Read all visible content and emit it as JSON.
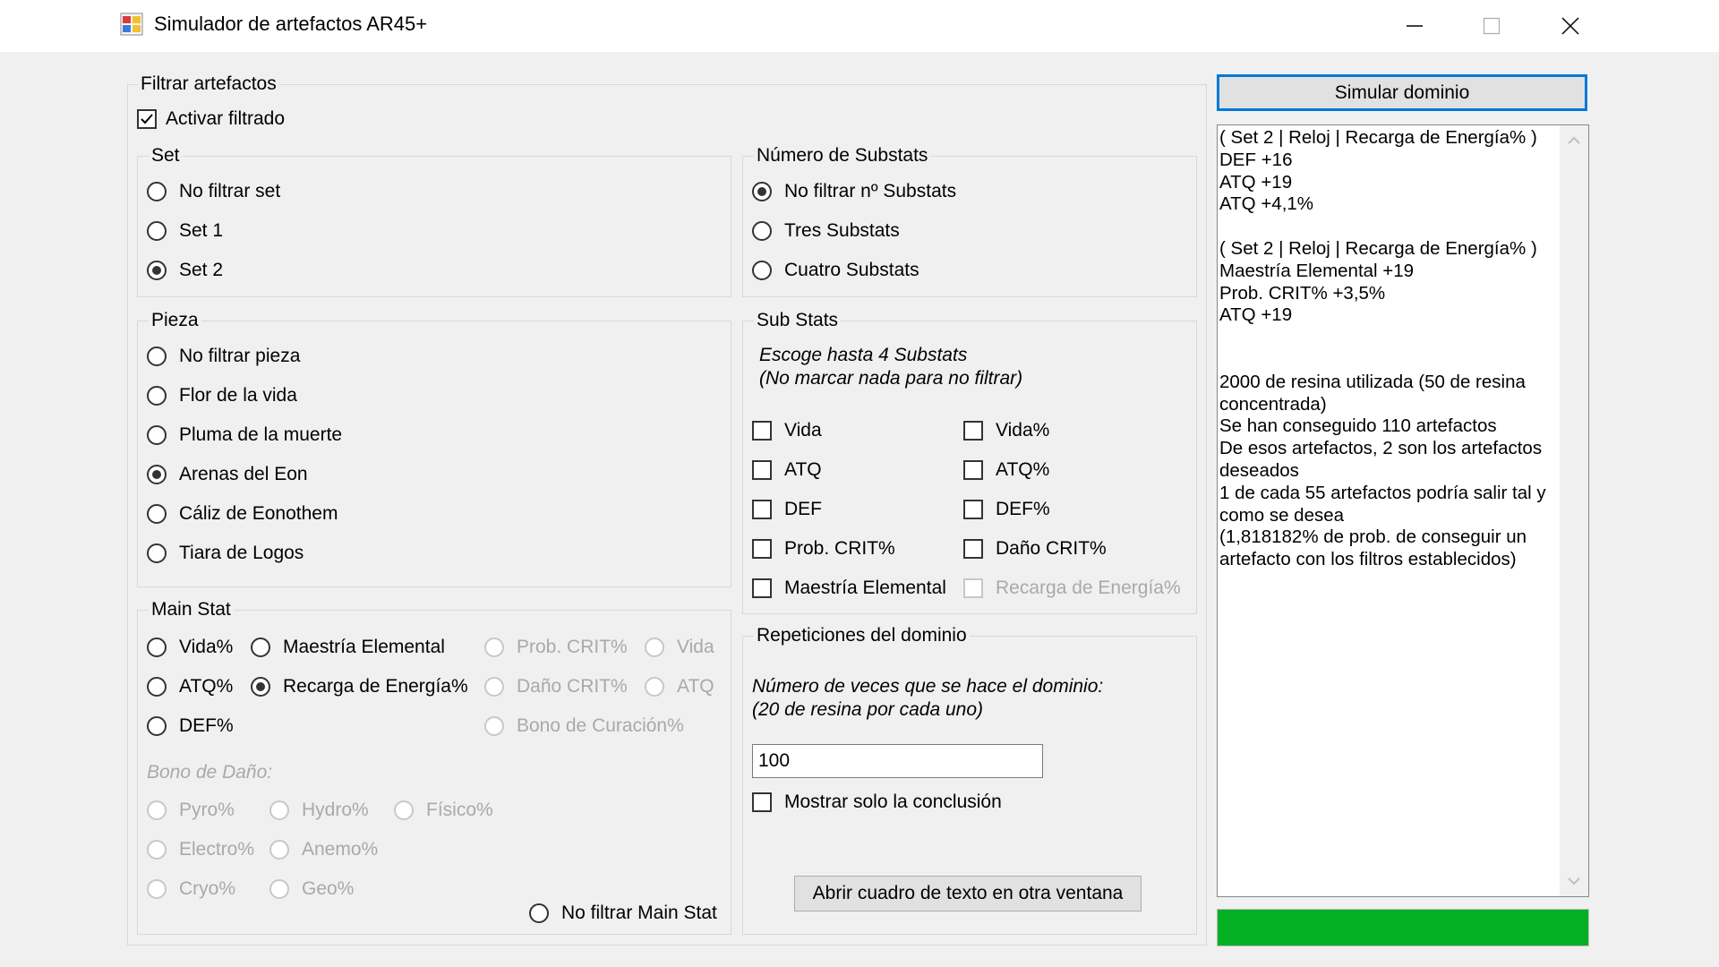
{
  "window": {
    "title": "Simulador de artefactos AR45+"
  },
  "filter": {
    "title": "Filtrar artefactos",
    "activate_label": "Activar filtrado",
    "activate_checked": true
  },
  "set": {
    "title": "Set",
    "options": [
      {
        "label": "No filtrar set",
        "checked": false
      },
      {
        "label": "Set 1",
        "checked": false
      },
      {
        "label": "Set 2",
        "checked": true
      }
    ]
  },
  "pieza": {
    "title": "Pieza",
    "options": [
      {
        "label": "No filtrar pieza",
        "checked": false
      },
      {
        "label": "Flor de la vida",
        "checked": false
      },
      {
        "label": "Pluma de la muerte",
        "checked": false
      },
      {
        "label": "Arenas del Eon",
        "checked": true
      },
      {
        "label": "Cáliz de Eonothem",
        "checked": false
      },
      {
        "label": "Tiara de Logos",
        "checked": false
      }
    ]
  },
  "main_stat": {
    "title": "Main Stat",
    "vida_pct": "Vida%",
    "maestria": "Maestría Elemental",
    "prob_crit": "Prob. CRIT%",
    "vida": "Vida",
    "atq_pct": "ATQ%",
    "recarga": "Recarga de Energía%",
    "danio_crit": "Daño CRIT%",
    "atq": "ATQ",
    "def_pct": "DEF%",
    "bono_curacion": "Bono de Curación%",
    "bono_danio_label": "Bono de Daño:",
    "pyro": "Pyro%",
    "hydro": "Hydro%",
    "fisico": "Físico%",
    "electro": "Electro%",
    "anemo": "Anemo%",
    "cryo": "Cryo%",
    "geo": "Geo%",
    "no_filtrar": "No filtrar Main Stat",
    "selected": "Recarga de Energía%"
  },
  "num_substats": {
    "title": "Número de Substats",
    "options": [
      {
        "label": "No filtrar nº Substats",
        "checked": true
      },
      {
        "label": "Tres Substats",
        "checked": false
      },
      {
        "label": "Cuatro Substats",
        "checked": false
      }
    ]
  },
  "sub_stats": {
    "title": "Sub Stats",
    "hint_line1": "Escoge hasta 4 Substats",
    "hint_line2": "(No marcar nada para no filtrar)",
    "vida": "Vida",
    "vida_pct": "Vida%",
    "atq": "ATQ",
    "atq_pct": "ATQ%",
    "def": "DEF",
    "def_pct": "DEF%",
    "prob_crit": "Prob. CRIT%",
    "danio_crit": "Daño CRIT%",
    "maestria": "Maestría Elemental",
    "recarga": "Recarga de Energía%"
  },
  "repeticiones": {
    "title": "Repeticiones del dominio",
    "hint_line1": "Número de veces que se hace el dominio:",
    "hint_line2": "(20 de resina por cada uno)",
    "value": "100",
    "solo_conclusion_label": "Mostrar solo la conclusión",
    "open_window_button": "Abrir cuadro de texto en otra ventana"
  },
  "simular_button": "Simular dominio",
  "results_text": "( Set 2 | Reloj | Recarga de Energía% )\nDEF +16\nATQ +19\nATQ +4,1%\n\n( Set 2 | Reloj | Recarga de Energía% )\nMaestría Elemental +19\nProb. CRIT% +3,5%\nATQ +19\n\n\n2000 de resina utilizada (50 de resina concentrada)\nSe han conseguido 110 artefactos\nDe esos artefactos, 2 son los artefactos deseados\n1 de cada 55 artefactos podría salir tal y como se desea\n(1,818182% de prob. de conseguir un artefacto con los filtros establecidos)",
  "progress": {
    "percent": 100,
    "color": "#06b025"
  },
  "colors": {
    "accent": "#0078d7",
    "window_bg": "#f0f0f0"
  }
}
